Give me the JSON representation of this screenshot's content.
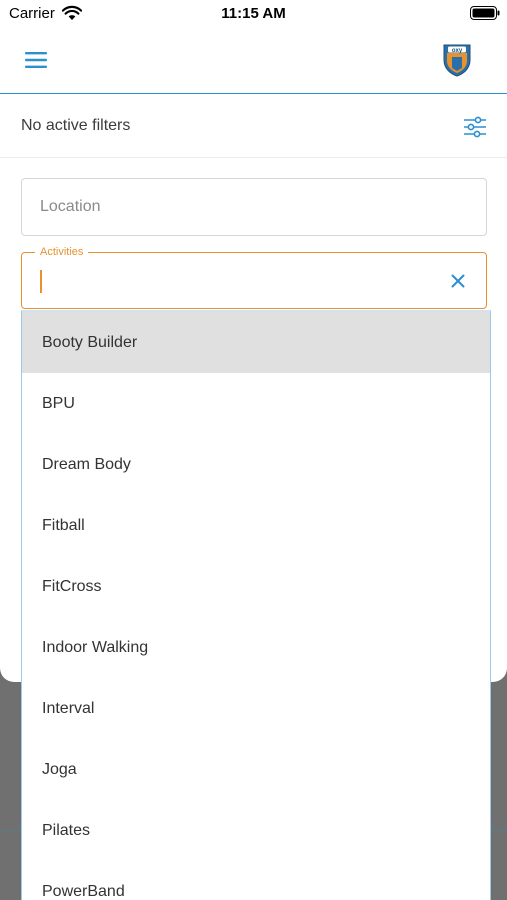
{
  "status_bar": {
    "carrier": "Carrier",
    "time": "11:15 AM"
  },
  "header": {
    "menu_icon": "hamburger-menu-icon",
    "logo": "oxy-shield-logo"
  },
  "filters": {
    "summary": "No active filters",
    "icon": "sliders-icon"
  },
  "location": {
    "placeholder": "Location",
    "value": ""
  },
  "activities": {
    "label": "Activities",
    "value": "",
    "clear_icon": "close-icon",
    "accent_color": "#e8922e",
    "options": [
      "Booty Builder",
      "BPU",
      "Dream Body",
      "Fitball",
      "FitCross",
      "Indoor Walking",
      "Interval",
      "Joga",
      "Pilates",
      "PowerBand"
    ],
    "highlighted_index": 0
  },
  "colors": {
    "primary": "#2b8fd0",
    "accent": "#e8922e",
    "highlight": "#e0e0e0"
  }
}
